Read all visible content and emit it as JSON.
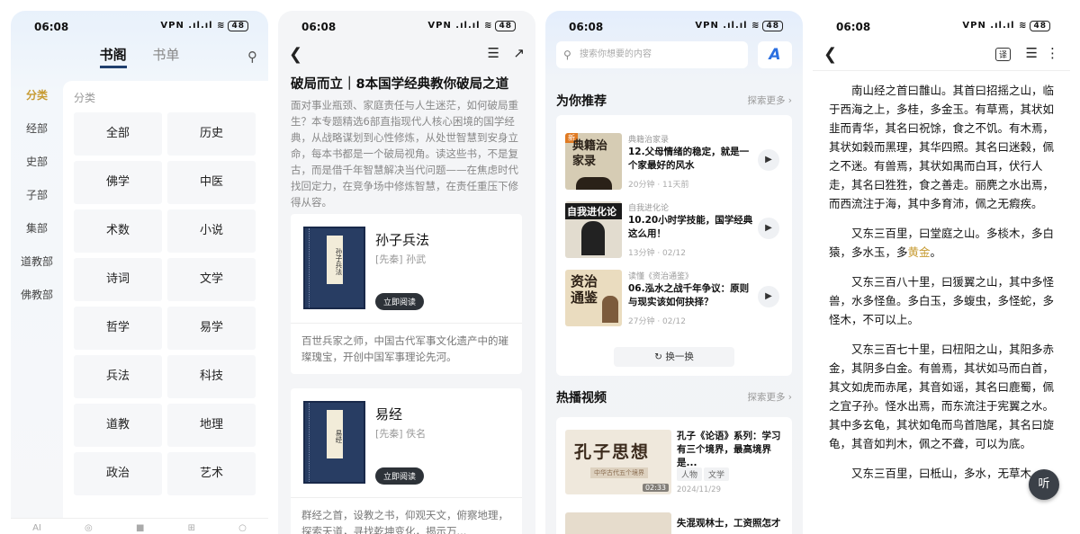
{
  "status_bar": {
    "time": "06:08",
    "more": "···",
    "right": "VPN .ıl.ıl ≋",
    "battery": "48"
  },
  "screen1": {
    "tabs": [
      "书阁",
      "书单"
    ],
    "side_categories": [
      "分类",
      "经部",
      "史部",
      "子部",
      "集部",
      "道教部",
      "佛教部"
    ],
    "panel_title": "分类",
    "grid": [
      "全部",
      "历史",
      "佛学",
      "中医",
      "术数",
      "小说",
      "诗词",
      "文学",
      "哲学",
      "易学",
      "兵法",
      "科技",
      "道教",
      "地理",
      "政治",
      "艺术"
    ],
    "nav": [
      "AI",
      "◎",
      "■",
      "⊞",
      "○"
    ]
  },
  "screen2": {
    "title": "破局而立｜8本国学经典教你破局之道",
    "description": "面对事业瓶颈、家庭责任与人生迷茫，如何破局重生？本专题精选6部直指现代人核心困境的国学经典，从战略谋划到心性修炼，从处世智慧到安身立命，每本书都是一个破局视角。读这些书，不是复古，而是借千年智慧解决当代问题——在焦虑时代找回定力，在竞争场中修炼智慧，在责任重压下修得从容。",
    "books": [
      {
        "name": "孙子兵法",
        "cover_label": "孙子兵法",
        "author": "[先秦] 孙武",
        "button": "立即阅读",
        "summary": "百世兵家之师，中国古代军事文化遗产中的璀璨瑰宝，开创中国军事理论先河。"
      },
      {
        "name": "易经",
        "cover_label": "易经",
        "author": "[先秦] 佚名",
        "button": "立即阅读",
        "summary": "群经之首，设教之书，仰观天文，俯察地理，探索天道，寻找乾坤变化，揭示万..."
      }
    ]
  },
  "screen3": {
    "search_placeholder": "搜索你想要的内容",
    "ai_label": "A",
    "recommend_title": "为你推荐",
    "more": "探索更多",
    "recommend_items": [
      {
        "thumb": "典籍治家录",
        "badge": "新",
        "source": "典籍治家录",
        "title": "12.父母情绪的稳定，就是一个家最好的风水",
        "meta": "20分钟 · 11天前"
      },
      {
        "thumb": "自我进化论",
        "source": "自我进化论",
        "title": "10.20小时学技能，国学经典这么用！",
        "meta": "13分钟 · 02/12"
      },
      {
        "thumb": "资治通鉴",
        "source": "读懂《资治通鉴》",
        "title": "06.泓水之战千年争议：原则与现实该如何抉择？",
        "meta": "27分钟 · 02/12"
      }
    ],
    "swap": "换一换",
    "hot_title": "热播视频",
    "video": {
      "thumb_title": "孔子思想",
      "thumb_sub": "中华古代五个境界",
      "duration": "02:33",
      "title": "孔子《论语》系列：学习有三个境界，最高境界是...",
      "tags": [
        "人物",
        "文学"
      ],
      "date": "2024/11/29"
    },
    "video2_title": "失混观林士，工资照怎才"
  },
  "screen4": {
    "translate": "译",
    "paragraphs": [
      {
        "before": "南山经之首曰䧿山。其首曰招摇之山，临于西海之上，多桂，多金玉。有草焉，其状如韭而青华，其名曰祝馀，食之不饥。有木焉，其状如榖而黑理，其华四照。其名曰迷榖，佩之不迷。有兽焉，其状如禺而白耳，伏行人走，其名曰狌狌，食之善走。丽麂之水出焉，而西流注于海，其中多育沛，佩之无瘕疾。",
        "gold": "",
        "after": ""
      },
      {
        "before": "又东三百里，曰堂庭之山。多棪木，多白猿，多水玉，多",
        "gold": "黄金",
        "after": "。"
      },
      {
        "before": "又东三百八十里，曰猨翼之山，其中多怪兽，水多怪鱼。多白玉，多蝮虫，多怪蛇，多怪木，不可以上。",
        "gold": "",
        "after": ""
      },
      {
        "before": "又东三百七十里，曰杻阳之山，其阳多赤金，其阴多白金。有兽焉，其状如马而白首，其文如虎而赤尾，其音如谣，其名曰鹿蜀，佩之宜子孙。怪水出焉，而东流注于宪翼之水。其中多玄龟，其状如龟而鸟首虺尾，其名曰旋龟，其音如判木，佩之不聋，可以为底。",
        "gold": "",
        "after": ""
      },
      {
        "before": "又东三百里，曰柢山，多水，无草木。",
        "gold": "",
        "after": ""
      }
    ],
    "listen": "听"
  }
}
